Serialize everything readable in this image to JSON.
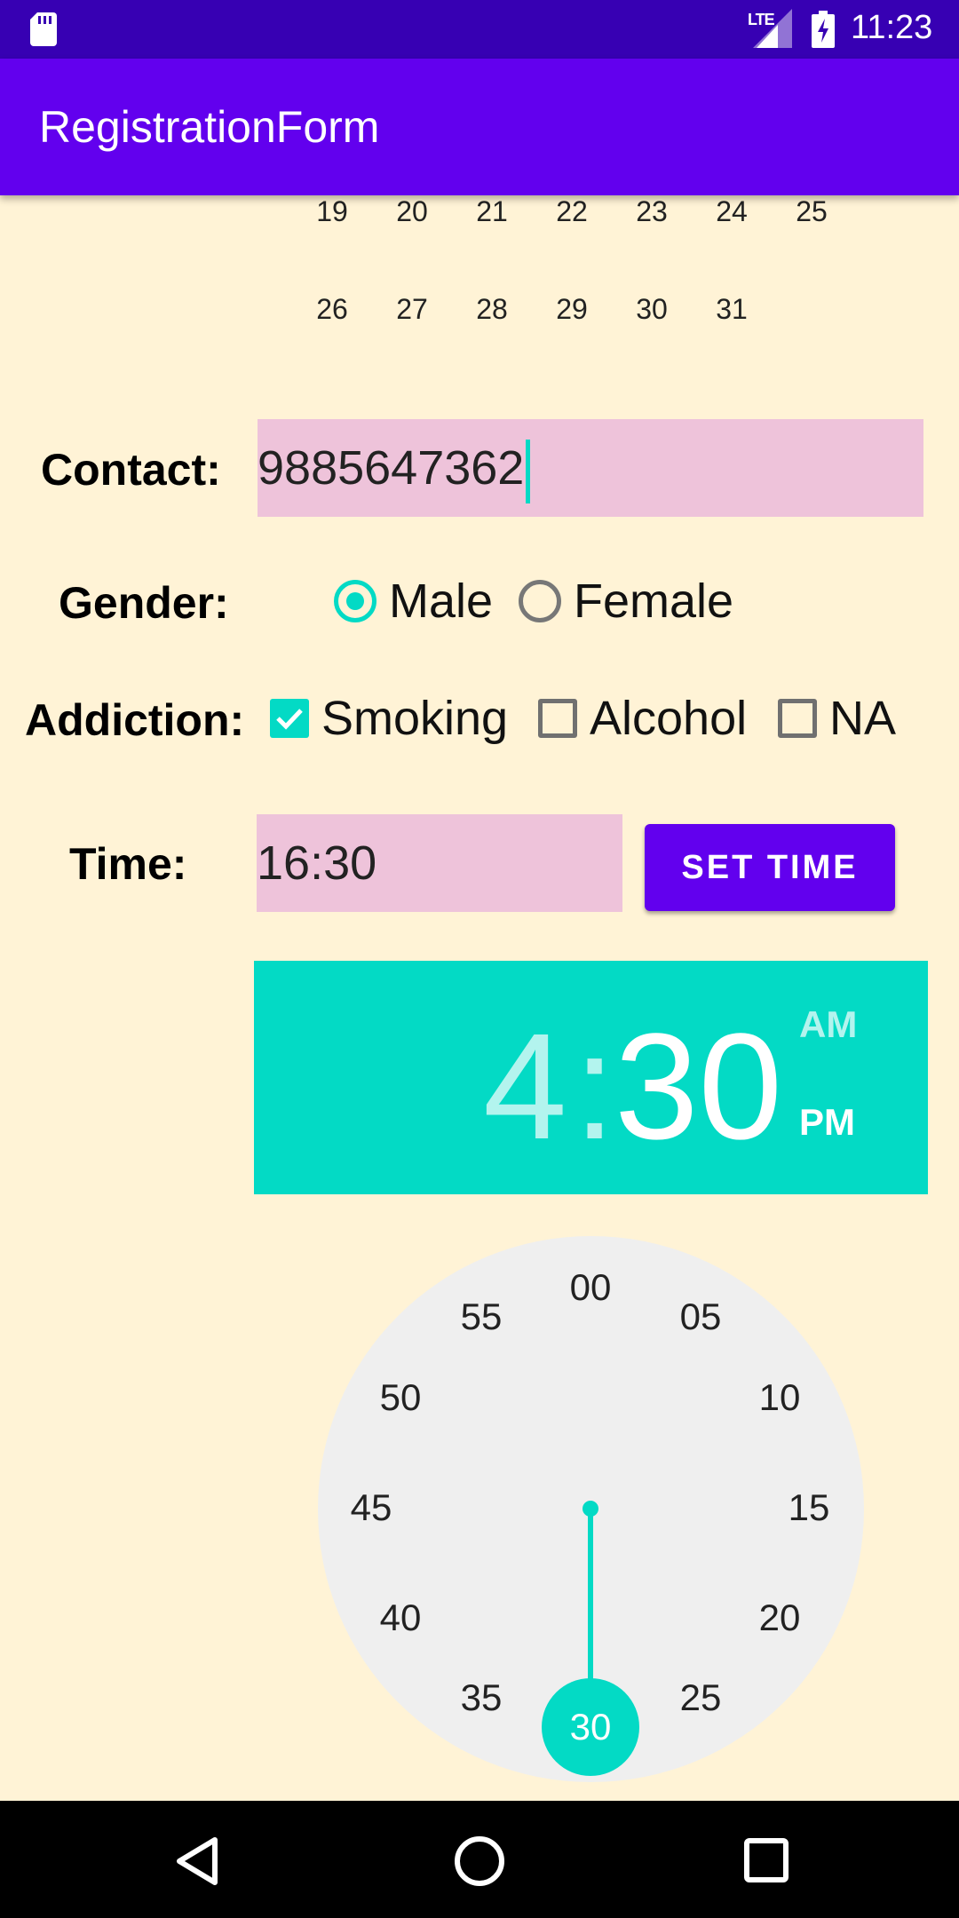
{
  "status_bar": {
    "time": "11:23",
    "network": "LTE",
    "icons": [
      "sd-card-icon",
      "signal-icon",
      "battery-charging-icon"
    ]
  },
  "app_bar": {
    "title": "RegistrationForm"
  },
  "calendar": {
    "row1": [
      "19",
      "20",
      "21",
      "22",
      "23",
      "24",
      "25"
    ],
    "row2": [
      "26",
      "27",
      "28",
      "29",
      "30",
      "31"
    ]
  },
  "contact": {
    "label": "Contact:",
    "value": "9885647362"
  },
  "gender": {
    "label": "Gender:",
    "options": [
      {
        "label": "Male",
        "selected": true
      },
      {
        "label": "Female",
        "selected": false
      }
    ]
  },
  "addiction": {
    "label": "Addiction:",
    "options": [
      {
        "label": "Smoking",
        "checked": true
      },
      {
        "label": "Alcohol",
        "checked": false
      },
      {
        "label": "NA",
        "checked": false
      }
    ]
  },
  "time": {
    "label": "Time:",
    "value": "16:30",
    "button": "SET TIME"
  },
  "time_picker": {
    "hour": "4",
    "separator": ":",
    "minute": "30",
    "am": "AM",
    "pm": "PM",
    "selected_period": "PM",
    "dial_numbers": [
      "00",
      "05",
      "10",
      "15",
      "20",
      "25",
      "30",
      "35",
      "40",
      "45",
      "50",
      "55"
    ],
    "selected": "30"
  },
  "colors": {
    "accent": "#03DAC5",
    "primary": "#6200EE",
    "primary_dark": "#3700B3",
    "field": "#EEC3DA",
    "background": "#FFF3D6"
  }
}
